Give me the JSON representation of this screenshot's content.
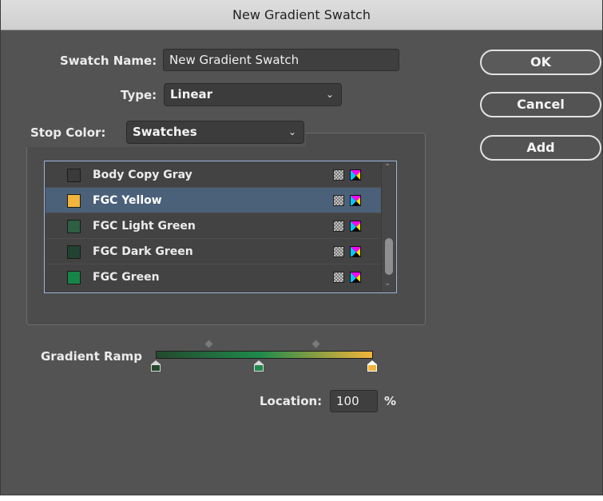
{
  "window": {
    "title": "New Gradient Swatch"
  },
  "swatch_name": {
    "label": "Swatch Name:",
    "value": "New Gradient Swatch"
  },
  "type": {
    "label": "Type:",
    "value": "Linear"
  },
  "stop_color": {
    "label": "Stop Color:",
    "value": "Swatches"
  },
  "buttons": {
    "ok": "OK",
    "cancel": "Cancel",
    "add": "Add"
  },
  "swatches": [
    {
      "name": "Body Copy Gray",
      "color": "#3a3a3a",
      "selected": false
    },
    {
      "name": "FGC Yellow",
      "color": "#f2b43a",
      "selected": true
    },
    {
      "name": "FGC Light Green",
      "color": "#2e5e43",
      "selected": false
    },
    {
      "name": "FGC Dark Green",
      "color": "#224232",
      "selected": false
    },
    {
      "name": "FGC Green",
      "color": "#178448",
      "selected": false
    }
  ],
  "gradient_ramp": {
    "label": "Gradient Ramp",
    "stops": [
      {
        "color": "#244a2e",
        "location": 0,
        "icon": "dark-green-stop"
      },
      {
        "color": "#1f8a4c",
        "location": 48,
        "icon": "green-stop"
      },
      {
        "color": "#f2b43a",
        "location": 100,
        "icon": "yellow-stop",
        "active": true
      }
    ],
    "midpoints": [
      24,
      74
    ]
  },
  "location": {
    "label": "Location:",
    "value": "100",
    "unit": "%"
  },
  "icons": {
    "spot_or_process": "pattern-swatch-icon",
    "color_mode": "cmyk-icon",
    "dropdown": "chevron-down-icon"
  }
}
